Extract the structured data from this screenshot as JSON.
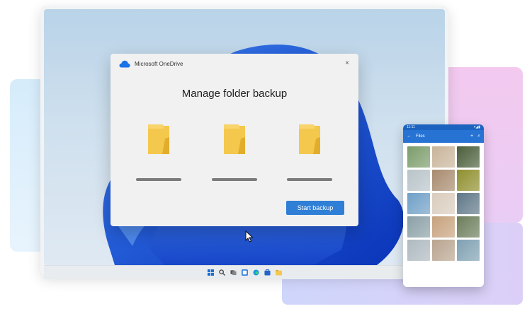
{
  "dialog": {
    "app_title": "Microsoft OneDrive",
    "close_label": "×",
    "heading": "Manage folder backup",
    "folders": [
      "folder",
      "folder",
      "folder"
    ],
    "start_button_label": "Start backup"
  },
  "phone": {
    "status_time": "11:11",
    "status_icons": "▾◢▮",
    "back_icon": "←",
    "title": "Files",
    "add_icon": "+",
    "search_icon": "⌕",
    "photos": [
      "#7b9c6b",
      "#c9b49a",
      "#4a5e3a",
      "#b8c4c9",
      "#a88a6e",
      "#8f8f2e",
      "#6f9fc7",
      "#d9ccbd",
      "#5f7787",
      "#8aa0a6",
      "#c7a27d",
      "#6b7d5a",
      "#aeb9c0",
      "#b9a48f",
      "#7fa0b2"
    ]
  },
  "colors": {
    "accent": "#2f7fd6",
    "folder": "#f4c84d",
    "phone_bar": "#2673d4"
  },
  "taskbar": {
    "icons": [
      "windows-icon",
      "search-icon",
      "task-view-icon",
      "widgets-icon",
      "edge-icon",
      "store-icon",
      "explorer-icon"
    ]
  }
}
